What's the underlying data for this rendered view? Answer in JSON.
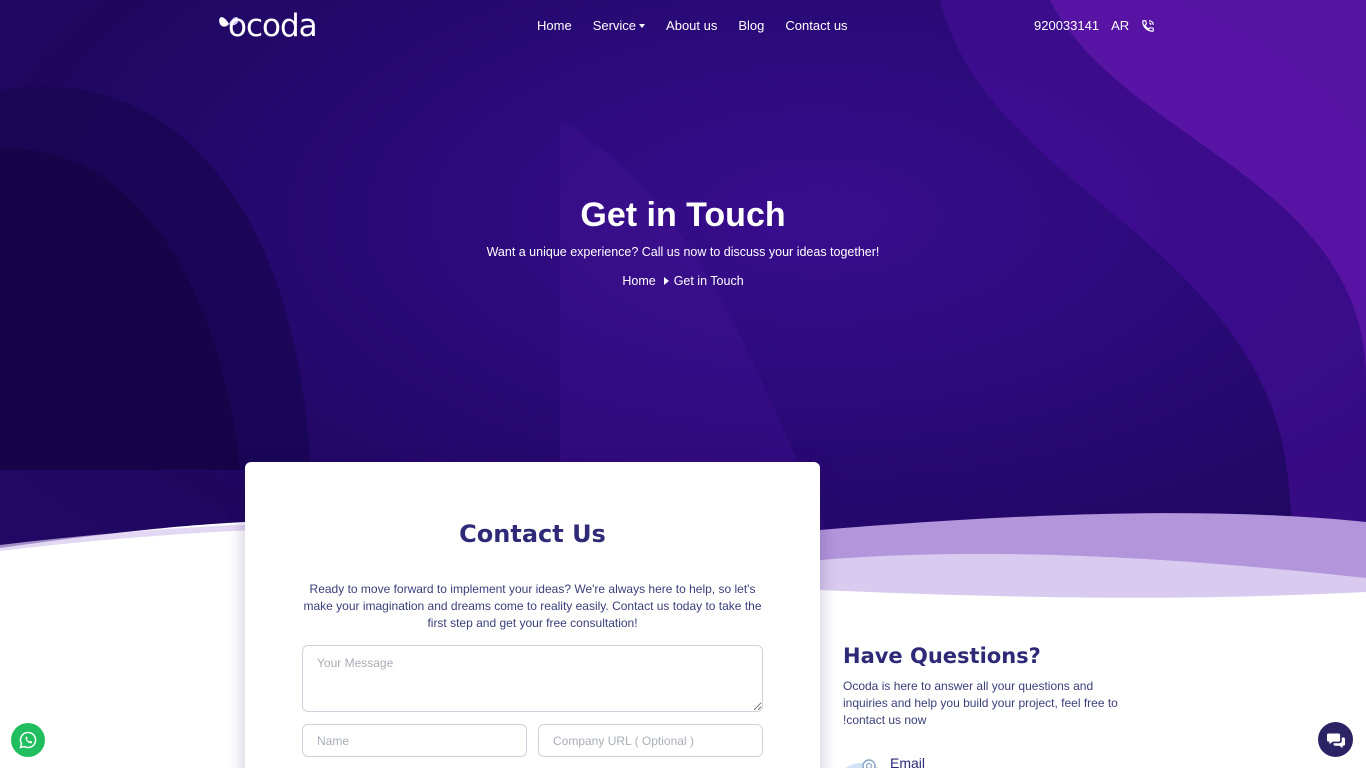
{
  "brand": {
    "name": "ocoda"
  },
  "nav": {
    "items": [
      "Home",
      "Service",
      "About us",
      "Blog",
      "Contact us"
    ]
  },
  "topbar": {
    "phone": "920033141",
    "lang": "AR"
  },
  "hero": {
    "title": "Get in Touch",
    "subtitle": "Want a unique experience? Call us now to discuss your ideas together!",
    "breadcrumb": [
      "Home",
      "Get in Touch"
    ]
  },
  "contact_form": {
    "title": "Contact Us",
    "description": "Ready to move forward to implement your ideas? We're always here to help, so let's make your imagination and dreams come to reality easily. Contact us today to take the first step and get your free consultation!",
    "message_placeholder": "Your Message",
    "name_placeholder": "Name",
    "url_placeholder": "Company URL ( Optional )"
  },
  "questions": {
    "title": "Have Questions?",
    "text": "Ocoda is here to answer all your questions and inquiries and help you build your project, feel free to !contact us now",
    "email_label": "Email"
  },
  "colors": {
    "hero_dark": "#1f0760",
    "hero_mid": "#3a0d8f",
    "accent_purple": "#6a1bb5",
    "heading": "#2e2a78",
    "whatsapp": "#1fbe5f",
    "chat": "#2b2363"
  },
  "icons": {
    "phone": "phone-icon",
    "whatsapp": "whatsapp-icon",
    "chat": "chat-icon",
    "email": "email-icon"
  }
}
